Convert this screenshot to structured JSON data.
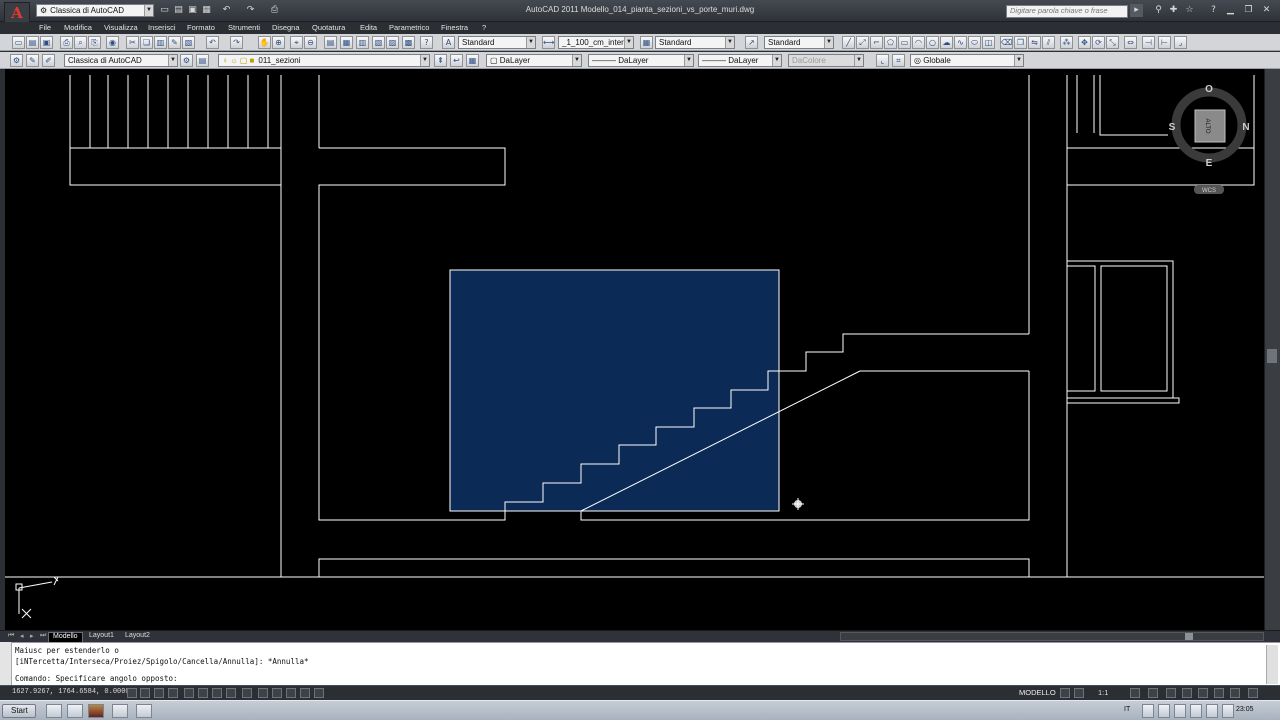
{
  "title_bar": {
    "workspace": "Classica di AutoCAD",
    "window_title": "AutoCAD 2011    Modello_014_pianta_sezioni_vs_porte_muri.dwg",
    "search_placeholder": "Digitare parola chiave o frase",
    "window_controls": [
      "minimize-icon",
      "restore-icon",
      "close-icon"
    ]
  },
  "menu": [
    "File",
    "Modifica",
    "Visualizza",
    "Inserisci",
    "Formato",
    "Strumenti",
    "Disegna",
    "Quotatura",
    "Edita",
    "Parametrico",
    "Finestra",
    "?"
  ],
  "styles_toolbar": {
    "text_style": "Standard",
    "dim_style": "_1_100_cm_inter",
    "table_style": "Standard",
    "multileader_style": "Standard"
  },
  "layers_toolbar": {
    "workspace": "Classica di AutoCAD",
    "layer": "011_sezioni",
    "color": "DaLayer",
    "linetype": "DaLayer",
    "lineweight": "DaLayer",
    "plotstyle": "DaColore",
    "ucs": "Globale"
  },
  "viewcube": {
    "face": "ALTO",
    "north": "N",
    "south": "S",
    "east": "E",
    "west": "O",
    "ucs_label": "WCS"
  },
  "layout_tabs": {
    "active": "Modello",
    "tabs": [
      "Modello",
      "Layout1",
      "Layout2"
    ]
  },
  "command_line": {
    "history_1": "Maiusc per estenderlo o",
    "history_2": "[iNTercetta/Interseca/Proiez/Spigolo/Cancella/Annulla]: *Annulla*",
    "prompt": "Comando: Specificare angolo opposto:"
  },
  "status_bar": {
    "coordinates": "1627.9267, 1764.6584, 0.0000",
    "space": "MODELLO",
    "annotation_scale": "1:1"
  },
  "taskbar": {
    "start_label": "Start",
    "language": "IT",
    "clock": "23:05"
  },
  "colors": {
    "selection_fill": "#0b2a55",
    "geometry": "#ffffff",
    "canvas": "#000000"
  }
}
